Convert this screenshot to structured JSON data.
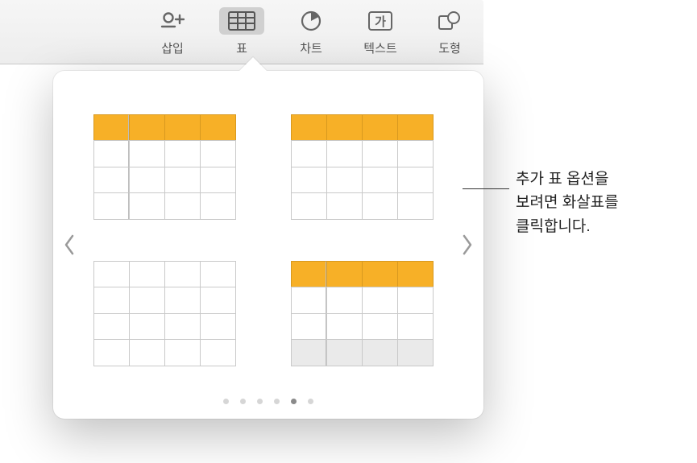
{
  "toolbar": {
    "buttons": [
      {
        "label": "삽입",
        "icon": "insert"
      },
      {
        "label": "표",
        "icon": "table",
        "active": true
      },
      {
        "label": "차트",
        "icon": "chart"
      },
      {
        "label": "텍스트",
        "icon": "text"
      },
      {
        "label": "도형",
        "icon": "shape"
      }
    ]
  },
  "popover": {
    "prev_icon": "chevron-left",
    "next_icon": "chevron-right",
    "page_count": 6,
    "active_page_index": 4,
    "styles": [
      {
        "header": true,
        "first_col_sep": true,
        "footer": false
      },
      {
        "header": true,
        "first_col_sep": false,
        "footer": false
      },
      {
        "header": false,
        "first_col_sep": false,
        "footer": false
      },
      {
        "header": true,
        "first_col_sep": true,
        "footer": true
      }
    ]
  },
  "callout": {
    "line1": "추가 표 옵션을",
    "line2": "보려면 화살표를",
    "line3": "클릭합니다."
  },
  "colors": {
    "accent": "#f7b027"
  }
}
